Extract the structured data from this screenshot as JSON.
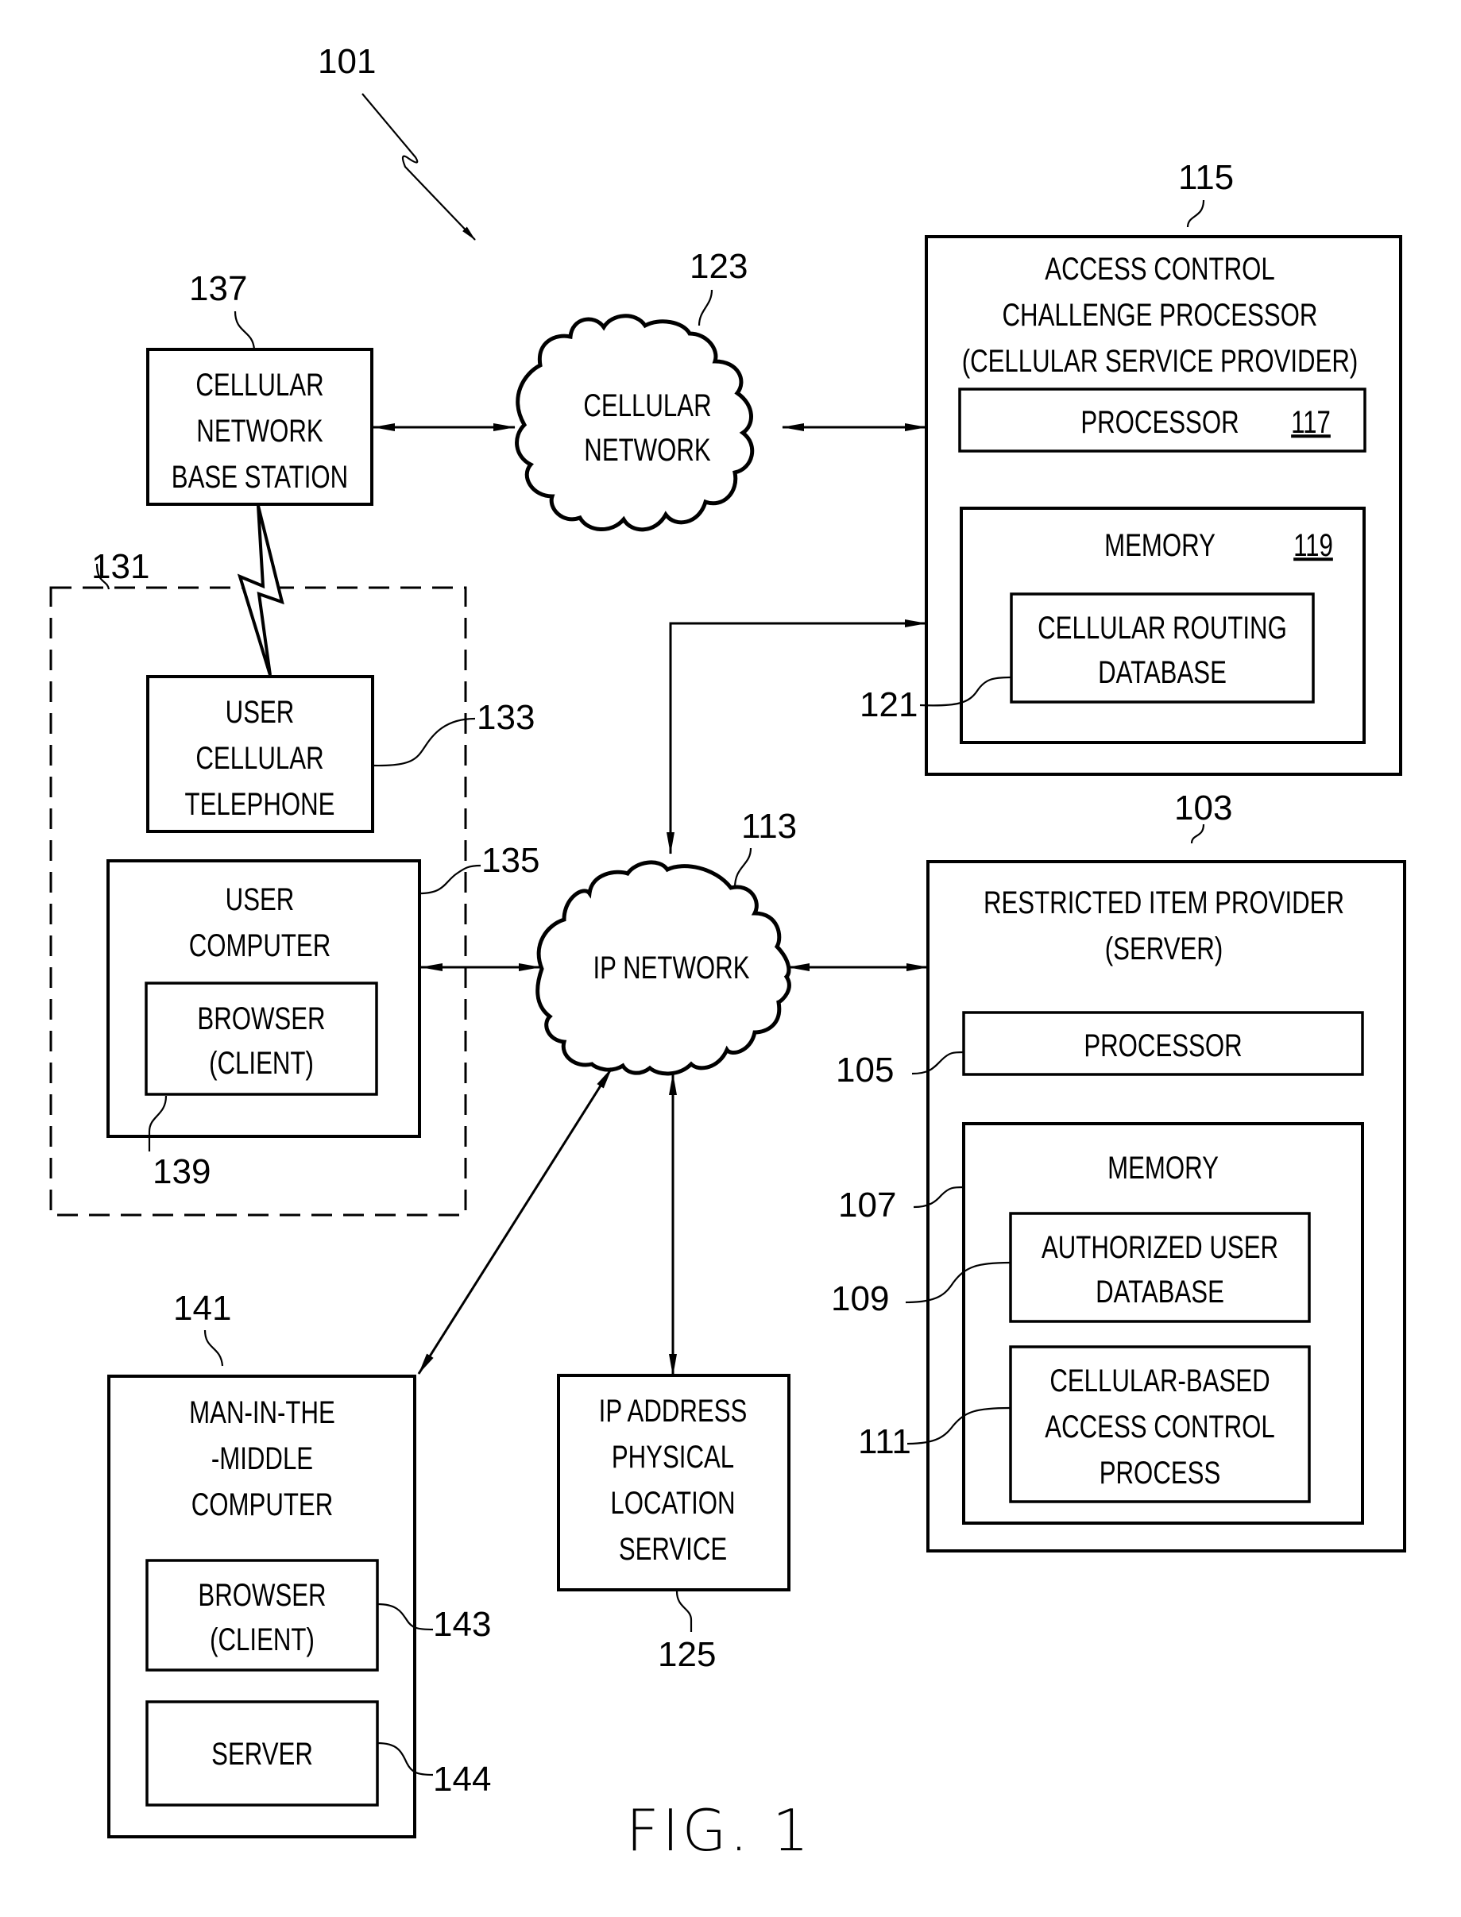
{
  "figure": {
    "caption": "FIG. 1",
    "system_ref": "101"
  },
  "colors": {
    "ink": "#000000",
    "paper": "#ffffff"
  },
  "nodes": {
    "base_station": {
      "ref": "137",
      "lines": [
        "CELLULAR",
        "NETWORK",
        "BASE STATION"
      ]
    },
    "cellular_network": {
      "ref": "123",
      "lines": [
        "CELLULAR",
        "NETWORK"
      ]
    },
    "access_control": {
      "ref": "115",
      "lines": [
        "ACCESS CONTROL",
        "CHALLENGE PROCESSOR",
        "(CELLULAR SERVICE PROVIDER)"
      ],
      "processor": {
        "label": "PROCESSOR",
        "ref": "117"
      },
      "memory": {
        "label": "MEMORY",
        "ref": "119"
      },
      "routing_db": {
        "ref": "121",
        "lines": [
          "CELLULAR ROUTING",
          "DATABASE"
        ]
      }
    },
    "user_group": {
      "ref": "131"
    },
    "user_phone": {
      "ref": "133",
      "lines": [
        "USER",
        "CELLULAR",
        "TELEPHONE"
      ]
    },
    "user_computer": {
      "ref": "135",
      "lines": [
        "USER",
        "COMPUTER"
      ]
    },
    "user_browser": {
      "ref": "139",
      "lines": [
        "BROWSER",
        "(CLIENT)"
      ]
    },
    "ip_network": {
      "ref": "113",
      "label": "IP NETWORK"
    },
    "server": {
      "ref": "103",
      "lines": [
        "RESTRICTED ITEM PROVIDER",
        "(SERVER)"
      ],
      "processor": {
        "label": "PROCESSOR",
        "ref": "105"
      },
      "memory": {
        "label": "MEMORY",
        "ref": "107"
      },
      "auth_db": {
        "ref": "109",
        "lines": [
          "AUTHORIZED USER",
          "DATABASE"
        ]
      },
      "access_process": {
        "ref": "111",
        "lines": [
          "CELLULAR-BASED",
          "ACCESS CONTROL",
          "PROCESS"
        ]
      }
    },
    "mitm": {
      "ref": "141",
      "lines": [
        "MAN-IN-THE",
        "-MIDDLE",
        "COMPUTER"
      ],
      "browser": {
        "ref": "143",
        "lines": [
          "BROWSER",
          "(CLIENT)"
        ]
      },
      "server": {
        "ref": "144",
        "label": "SERVER"
      }
    },
    "ip_location": {
      "ref": "125",
      "lines": [
        "IP ADDRESS",
        "PHYSICAL",
        "LOCATION",
        "SERVICE"
      ]
    }
  }
}
